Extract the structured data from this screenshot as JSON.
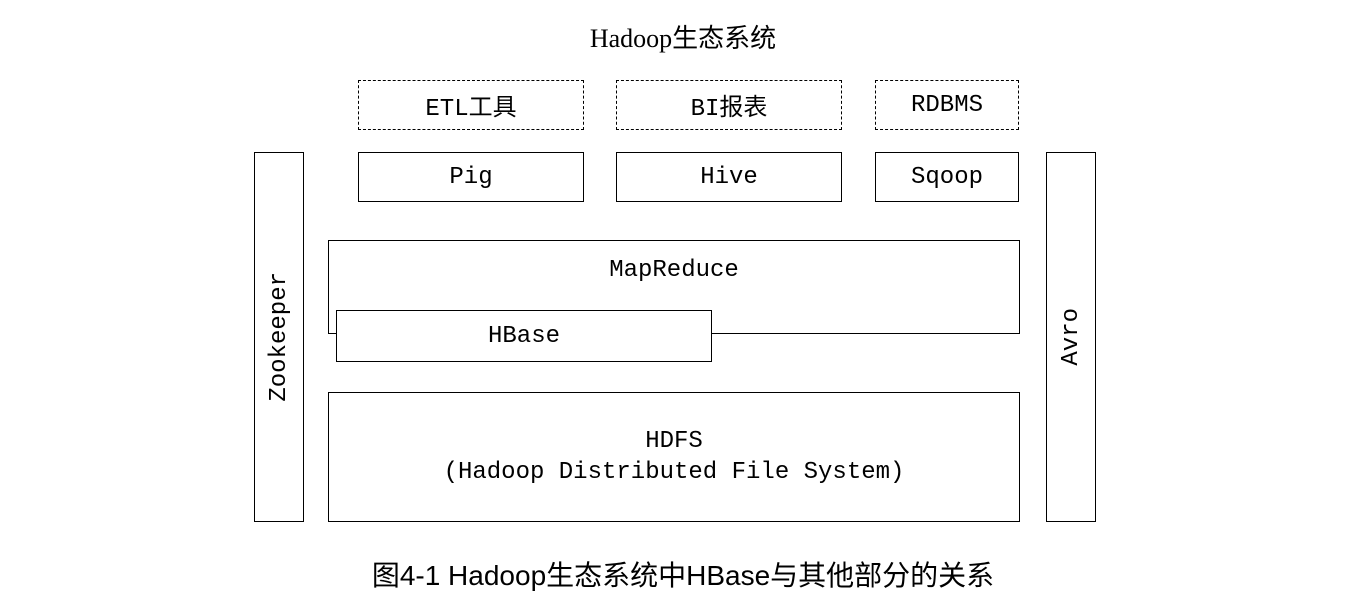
{
  "title": "Hadoop生态系统",
  "caption": "图4-1 Hadoop生态系统中HBase与其他部分的关系",
  "row1": {
    "etl": "ETL工具",
    "bi": "BI报表",
    "rdbms": "RDBMS"
  },
  "row2": {
    "pig": "Pig",
    "hive": "Hive",
    "sqoop": "Sqoop"
  },
  "mapreduce": "MapReduce",
  "hbase": "HBase",
  "hdfs_line1": "HDFS",
  "hdfs_line2": "(Hadoop Distributed File System)",
  "zookeeper": "Zookeeper",
  "avro": "Avro"
}
